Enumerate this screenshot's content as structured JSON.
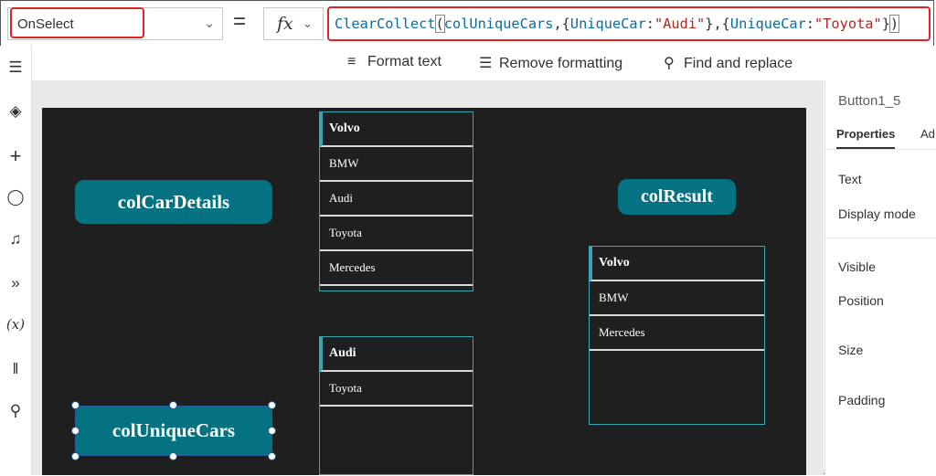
{
  "formula_bar": {
    "property": "OnSelect",
    "equals": "=",
    "fx_label": "fx",
    "formula_parts": {
      "fn": "ClearCollect",
      "open": "(",
      "coll": "colUniqueCars",
      "sep1": ",{",
      "key1": "UniqueCar",
      "colon1": ":",
      "val1": "\"Audi\"",
      "close1": "},{",
      "key2": "UniqueCar",
      "colon2": ":",
      "val2": "\"Toyota\"",
      "close2": "}",
      "close": ")"
    }
  },
  "format_toolbar": {
    "format_text": "Format text",
    "remove_formatting": "Remove formatting",
    "find_replace": "Find and replace"
  },
  "rail_icons": [
    "hamburger-icon",
    "layers-icon",
    "plus-icon",
    "data-icon",
    "media-icon",
    "power-automate-icon",
    "variables-icon",
    "tools-icon",
    "search-icon"
  ],
  "canvas": {
    "btn_car_details": "colCarDetails",
    "btn_unique_cars": "colUniqueCars",
    "btn_result": "colResult",
    "gallery_car_details": [
      "Volvo",
      "BMW",
      "Audi",
      "Toyota",
      "Mercedes"
    ],
    "gallery_unique_cars": [
      "Audi",
      "Toyota"
    ],
    "gallery_result": [
      "Volvo",
      "BMW",
      "Mercedes"
    ]
  },
  "right_panel": {
    "control_name": "Button1_5",
    "tab_properties": "Properties",
    "tab_advanced": "Ad",
    "labels": {
      "text": "Text",
      "display_mode": "Display mode",
      "visible": "Visible",
      "position": "Position",
      "size": "Size",
      "padding": "Padding"
    }
  },
  "colors": {
    "button_teal": "#057282",
    "highlight_red": "#e02424",
    "canvas_dark": "#1f1f1f",
    "selection_blue": "#2b5c9e"
  }
}
